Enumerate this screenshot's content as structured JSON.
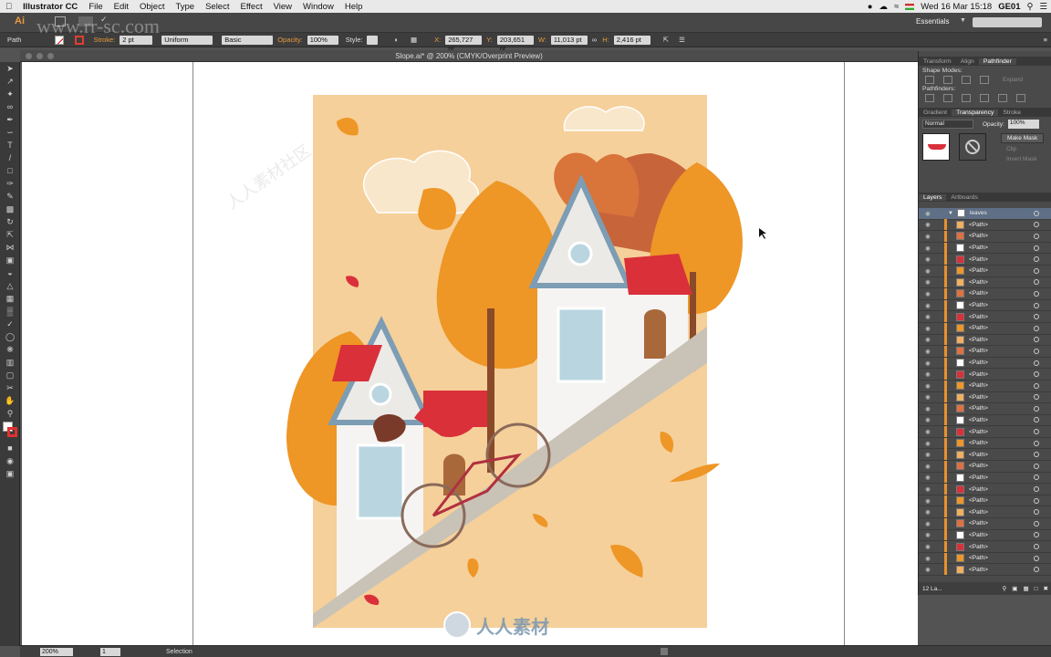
{
  "menubar": {
    "app": "Illustrator CC",
    "items": [
      "File",
      "Edit",
      "Object",
      "Type",
      "Select",
      "Effect",
      "View",
      "Window",
      "Help"
    ],
    "datetime": "Wed 16 Mar  15:18",
    "user": "GE01"
  },
  "appbar": {
    "workspace": "Essentials",
    "logo": "Ai"
  },
  "control": {
    "selection": "Path",
    "stroke_label": "Stroke:",
    "stroke_weight": "2 pt",
    "profile": "Uniform",
    "brush": "Basic",
    "opacity_label": "Opacity:",
    "opacity": "100%",
    "style_label": "Style:",
    "x_label": "X:",
    "x": "265,727 pt",
    "y_label": "Y:",
    "y": "203,651 pt",
    "w_label": "W:",
    "w": "11,013 pt",
    "h_label": "H:",
    "h": "2,416 pt"
  },
  "document": {
    "title": "Slope.ai* @ 200% (CMYK/Overprint Preview)"
  },
  "status": {
    "zoom": "200%",
    "artboard": "1",
    "tool": "Selection"
  },
  "panels": {
    "top_tabs": [
      "Transform",
      "Align",
      "Pathfinder"
    ],
    "shape_modes": "Shape Modes:",
    "expand": "Expand",
    "pathfinders": "Pathfinders:",
    "mid_tabs": [
      "Gradient",
      "Transparency",
      "Stroke"
    ],
    "blend_mode": "Normal",
    "opacity_label": "Opacity:",
    "opacity": "100%",
    "make_mask": "Make Mask",
    "clip": "Clip",
    "invert_mask": "Invert Mask",
    "layer_tabs": [
      "Layers",
      "Artboards"
    ],
    "layer_name": "leaves",
    "path_label": "<Path>",
    "layer_count": "12 La..."
  },
  "colors": {
    "accent": "#e8912f",
    "bg": "#f5d09a",
    "roof": "#d9303a"
  },
  "watermark": {
    "url": "www.rr-sc.com",
    "cn": "人人素材社区",
    "logo_cn": "人人素材"
  }
}
